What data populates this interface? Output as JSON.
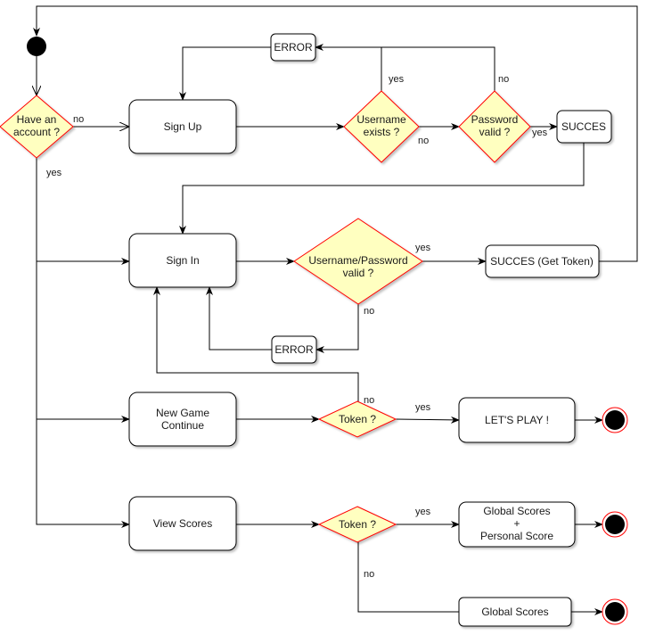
{
  "colors": {
    "decision_fill": "#ffffc0",
    "decision_stroke": "#ff0000",
    "final_ring": "#ff0000",
    "node": "#000000"
  },
  "nodes": {
    "have_account": [
      "Have an",
      "account ?"
    ],
    "sign_up": "Sign Up",
    "error_signup": "ERROR",
    "username_exists": [
      "Username",
      "exists ?"
    ],
    "password_valid": [
      "Password",
      "valid ?"
    ],
    "succes": "SUCCES",
    "sign_in": "Sign In",
    "up_valid": [
      "Username/Password",
      "valid ?"
    ],
    "succes_token": "SUCCES (Get Token)",
    "error_signin": "ERROR",
    "new_game": [
      "New Game",
      "Continue"
    ],
    "token1": "Token ?",
    "lets_play": "LET'S PLAY !",
    "view_scores": "View Scores",
    "token2": "Token ?",
    "global_personal": [
      "Global Scores",
      "+",
      "Personal Score"
    ],
    "global_scores": "Global Scores"
  },
  "labels": {
    "yes": "yes",
    "no": "no"
  }
}
